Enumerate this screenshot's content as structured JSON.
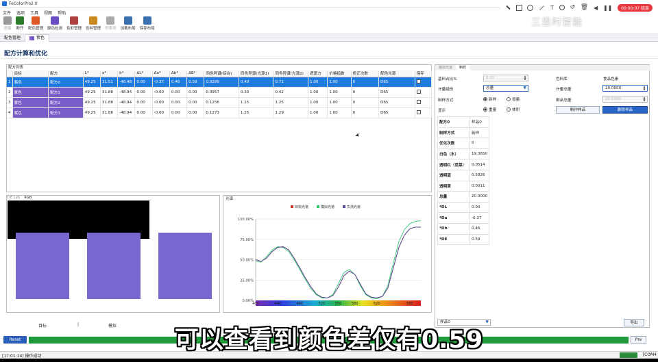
{
  "app": {
    "title": "FeColorPro2.0"
  },
  "menu": [
    "文件",
    "选项",
    "工具",
    "视图",
    "帮助"
  ],
  "overlay": {
    "rec_label": "00:00:07 结束",
    "watermark": "三恩时智能"
  },
  "toolbar": [
    {
      "label": "连接",
      "icon": "plug-icon",
      "disabled": true,
      "color": "#999999"
    },
    {
      "label": "断开",
      "icon": "unplug-icon",
      "disabled": false,
      "color": "#2a7a2a"
    },
    {
      "label": "配色管理",
      "icon": "palette-icon",
      "disabled": false,
      "color": "#e05a28"
    },
    {
      "label": "颜色检测",
      "icon": "detect-icon",
      "disabled": false,
      "color": "#6a4cc2"
    },
    {
      "label": "色彩管理",
      "icon": "color-manage-icon",
      "disabled": false,
      "color": "#b04040"
    },
    {
      "label": "色料管理",
      "icon": "pigment-icon",
      "disabled": false,
      "color": "#c98a1e"
    },
    {
      "label": "列表项",
      "icon": "list-icon",
      "disabled": true,
      "color": "#aaaaaa"
    },
    {
      "label": "加载布局",
      "icon": "load-layout-icon",
      "disabled": false,
      "color": "#3a6fb0"
    },
    {
      "label": "保存布局",
      "icon": "save-layout-icon",
      "disabled": false,
      "color": "#3a6fb0"
    }
  ],
  "doc_tabs": [
    {
      "label": "配色管理",
      "active": false
    },
    {
      "label": "紫色",
      "active": true
    }
  ],
  "page_title": "配方计算和优化",
  "formula_table": {
    "caption": "配方列表",
    "headers": [
      "目标",
      "配方",
      "L*",
      "a*",
      "b*",
      "ΔL*",
      "Δa*",
      "Δb*",
      "ΔE*",
      "同色异谱(综合)",
      "同色异谱(光源1)",
      "同色异谱(光源2)",
      "遮盖力",
      "价格指数",
      "修正次数",
      "配色光源",
      "保存"
    ],
    "rows": [
      {
        "idx": "1",
        "cells": [
          "紫色",
          "配方0",
          "49.25",
          "31.51",
          "-48.48",
          "0.00",
          "-0.37",
          "0.46",
          "0.59",
          "0.0289",
          "0.40",
          "0.71",
          "1.00",
          "1.00",
          "0",
          "D65",
          ""
        ],
        "selected": true
      },
      {
        "idx": "2",
        "cells": [
          "紫色",
          "配方1",
          "49.25",
          "31.88",
          "-48.94",
          "0.00",
          "-0.00",
          "0.00",
          "0.00",
          "0.0957",
          "0.33",
          "0.42",
          "1.00",
          "1.00",
          "0",
          "D65",
          ""
        ],
        "selected": false
      },
      {
        "idx": "3",
        "cells": [
          "紫色",
          "配方2",
          "49.25",
          "31.88",
          "-48.94",
          "0.00",
          "-0.00",
          "0.00",
          "0.00",
          "0.1256",
          "1.15",
          "1.25",
          "1.00",
          "1.00",
          "0",
          "D65",
          ""
        ],
        "selected": false
      },
      {
        "idx": "4",
        "cells": [
          "紫色",
          "配方3",
          "49.25",
          "31.88",
          "-48.94",
          "0.00",
          "-0.00",
          "0.00",
          "0.00",
          "0.1273",
          "1.25",
          "1.29",
          "1.00",
          "1.00",
          "0",
          "D65",
          ""
        ],
        "selected": false
      }
    ]
  },
  "swatch_panel": {
    "tabs": [
      "CIE Lab",
      "RGB"
    ],
    "labels": [
      "目标",
      "|",
      "模拟"
    ],
    "swatch_color": "#7a66cf"
  },
  "spectrum": {
    "title": "光谱",
    "legend": [
      "目标光谱",
      "模拟光谱",
      "实测光谱"
    ],
    "legend_colors": [
      "#c0392b",
      "#2ecc71",
      "#5b4b9a"
    ]
  },
  "right_panel": {
    "tabs": [
      "模拟光谱",
      "制样"
    ],
    "base_label": "基料占比%",
    "base_value": "0.00",
    "lib_label": "色料库",
    "lib_value": "食品色素",
    "unit_label": "计量组份",
    "unit_value": "总量",
    "total_label": "计量总量",
    "total_value": "20.0000",
    "method_label": "制样方式",
    "method_opts": [
      "新样",
      "增量"
    ],
    "remain_label": "剩余总量",
    "remain_value": "20.0000",
    "show_label": "显示",
    "show_opts": [
      "重量",
      "体积"
    ],
    "btn_make": "制作样品",
    "btn_del": "删除样品",
    "grid": [
      [
        "配方0",
        "样品0"
      ],
      [
        "制样方式",
        "新样"
      ],
      [
        "优化次数",
        "0"
      ],
      [
        "白色（水）",
        "19.3650"
      ],
      [
        "透明红（苋菜）",
        "0.0514"
      ],
      [
        "透明蓝",
        "0.5826"
      ],
      [
        "透明黄",
        "0.0011"
      ],
      [
        "总量",
        "20.0000"
      ],
      [
        "*DL",
        "0.00"
      ],
      [
        "*Da",
        "-0.37"
      ],
      [
        "*Db",
        "0.46"
      ],
      [
        "*DE",
        "0.59"
      ]
    ],
    "bottom_select": "样品0",
    "export": "导出"
  },
  "bottom": {
    "reset": "Reset",
    "pre": "Pre"
  },
  "status": {
    "text": "[17:01:14] 操作成功",
    "com": "[COM4"
  },
  "subtitle": "可以查看到颜色差仅有0.59",
  "chart_data": {
    "type": "line",
    "title": "光谱",
    "x": [
      400,
      410,
      420,
      430,
      440,
      450,
      460,
      470,
      480,
      490,
      500,
      510,
      520,
      530,
      540,
      550,
      560,
      570,
      580,
      590,
      600,
      610,
      620,
      630,
      640,
      650,
      660,
      670,
      680,
      690,
      700
    ],
    "x_tick_labels": [
      "400",
      "440",
      "480",
      "520",
      "550",
      "580",
      "620",
      "680"
    ],
    "ylabel": "",
    "y_tick_labels": [
      "0.00%",
      "25.00%",
      "50.00%",
      "75.00%",
      "100.00%"
    ],
    "ylim": [
      0,
      100
    ],
    "series": [
      {
        "name": "目标光谱",
        "values": [
          50,
          48,
          52,
          60,
          65,
          66,
          62,
          52,
          40,
          28,
          17,
          8,
          4,
          3,
          6,
          16,
          30,
          36,
          32,
          20,
          8,
          4,
          3,
          5,
          15,
          40,
          65,
          80,
          88,
          90,
          90
        ]
      },
      {
        "name": "模拟光谱",
        "values": [
          48,
          47,
          54,
          62,
          66,
          65,
          60,
          50,
          38,
          26,
          15,
          7,
          3,
          3,
          7,
          20,
          34,
          38,
          32,
          18,
          7,
          3,
          2,
          5,
          18,
          46,
          72,
          87,
          94,
          97,
          98
        ]
      },
      {
        "name": "实测光谱",
        "values": [
          50,
          48,
          52,
          60,
          65,
          66,
          62,
          52,
          40,
          28,
          17,
          8,
          4,
          3,
          6,
          16,
          30,
          36,
          32,
          20,
          8,
          4,
          3,
          5,
          15,
          40,
          65,
          80,
          88,
          90,
          90
        ]
      }
    ]
  }
}
